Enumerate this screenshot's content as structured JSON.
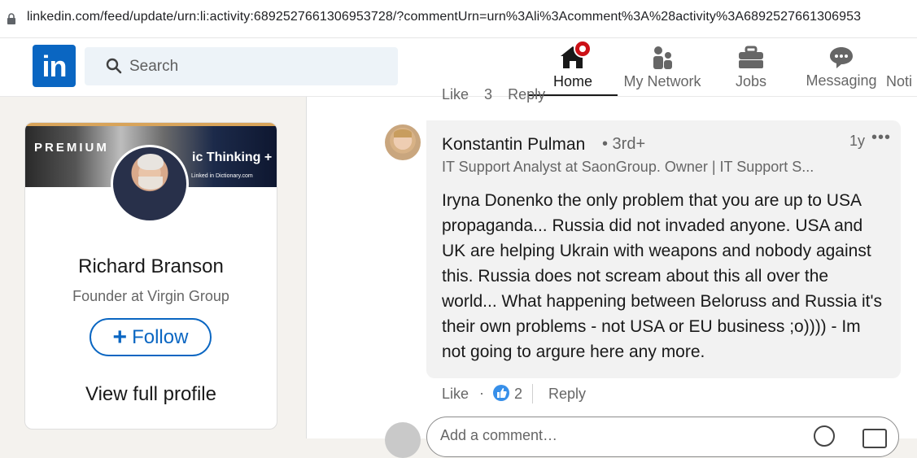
{
  "browser": {
    "url": "linkedin.com/feed/update/urn:li:activity:6892527661306953728/?commentUrn=urn%3Ali%3Acomment%3A%28activity%3A6892527661306953"
  },
  "header": {
    "logo_text": "in",
    "search_placeholder": "Search",
    "nav": [
      {
        "label": "Home",
        "icon": "home-icon",
        "active": true,
        "badge": true
      },
      {
        "label": "My Network",
        "icon": "people-icon"
      },
      {
        "label": "Jobs",
        "icon": "briefcase-icon"
      },
      {
        "label": "Messaging",
        "icon": "chat-icon"
      },
      {
        "label": "Noti",
        "icon": "bell-icon"
      }
    ]
  },
  "profile_card": {
    "banner_label": "PREMIUM",
    "banner_text": "ic Thinking +",
    "banner_small": "Linked in  Dictionary.com",
    "name": "Richard Branson",
    "title": "Founder at Virgin Group",
    "follow_label": "Follow",
    "view_profile_label": "View full profile"
  },
  "previous_comment_actions": {
    "like_label": "Like",
    "count": "3",
    "reply_label": "Reply"
  },
  "comment": {
    "author": "Konstantin Pulman",
    "degree": "• 3rd+",
    "time": "1y",
    "more": "•••",
    "headline": "IT Support Analyst at SaonGroup. Owner | IT Support S...",
    "text": "Iryna Donenko the only problem that you are up to USA propaganda... Russia did not invaded anyone. USA and UK are helping Ukrain with weapons and nobody against this. Russia does not scream about this all over the world... What happening between Beloruss and Russia it's their own problems - not USA or EU business ;o)))) - Im not going to argure here any more.",
    "like_label": "Like",
    "reaction_count": "2",
    "reply_label": "Reply"
  },
  "add_comment": {
    "placeholder": "Add a comment…"
  },
  "colors": {
    "brand": "#0a66c2",
    "badge": "#cc1016",
    "bubble": "#f2f2f2"
  }
}
